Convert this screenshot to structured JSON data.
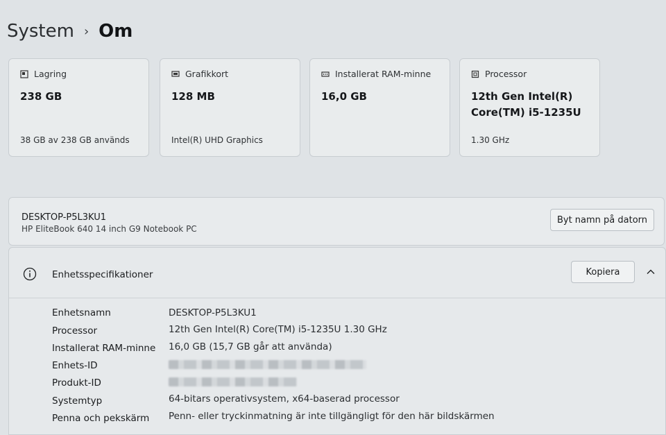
{
  "breadcrumb": {
    "root": "System",
    "separator": "›",
    "current": "Om"
  },
  "cards": [
    {
      "label": "Lagring",
      "value": "238 GB",
      "sub": "38 GB av 238 GB används",
      "icon": "storage-icon"
    },
    {
      "label": "Grafikkort",
      "value": "128 MB",
      "sub": "Intel(R) UHD Graphics",
      "icon": "graphics-card-icon"
    },
    {
      "label": "Installerat RAM-minne",
      "value": "16,0 GB",
      "sub": "",
      "icon": "ram-icon"
    },
    {
      "label": "Processor",
      "value": "12th Gen Intel(R) Core(TM) i5-1235U",
      "sub": "1.30 GHz",
      "icon": "processor-icon"
    }
  ],
  "device": {
    "name": "DESKTOP-P5L3KU1",
    "model": "HP EliteBook 640 14 inch G9 Notebook PC",
    "rename_button": "Byt namn på datorn"
  },
  "specs": {
    "title": "Enhetsspecifikationer",
    "copy_button": "Kopiera",
    "rows": [
      {
        "label": "Enhetsnamn",
        "value": "DESKTOP-P5L3KU1"
      },
      {
        "label": "Processor",
        "value": "12th Gen Intel(R) Core(TM) i5-1235U   1.30 GHz"
      },
      {
        "label": "Installerat RAM-minne",
        "value": "16,0 GB (15,7 GB går att använda)"
      },
      {
        "label": "Enhets-ID",
        "value": ""
      },
      {
        "label": "Produkt-ID",
        "value": ""
      },
      {
        "label": "Systemtyp",
        "value": "64-bitars operativsystem, x64-baserad processor"
      },
      {
        "label": "Penna och pekskärm",
        "value": "Penn- eller tryckinmatning är inte tillgängligt för den här bildskärmen"
      }
    ]
  }
}
